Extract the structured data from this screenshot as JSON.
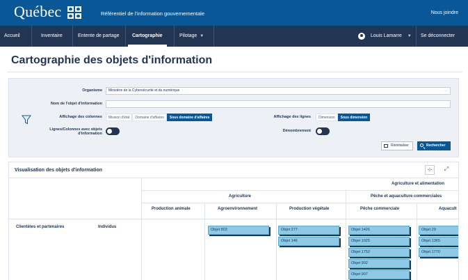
{
  "header": {
    "logo_text": "Québec",
    "site_title": "Référentiel de l'information gouvernementale",
    "contact_link": "Nous joindre",
    "brand_color": "#095797"
  },
  "nav": {
    "items": [
      {
        "label": "Accueil"
      },
      {
        "label": "Inventaire"
      },
      {
        "label": "Entente de partage"
      },
      {
        "label": "Cartographie",
        "active": true
      },
      {
        "label": "Pilotage"
      }
    ],
    "user_name": "Louis Lamarre",
    "logout": "Se déconnecter",
    "nav_color": "#223654"
  },
  "page": {
    "title": "Cartographie des objets d'information"
  },
  "filters": {
    "organisme_label": "Organisme",
    "organisme_value": "Ministère de la Cybersécurité et du numérique",
    "nom_label": "Nom de l'objet d'information",
    "nom_value": "",
    "colonnes_label": "Affichage des colonnes",
    "colonnes_options": [
      "Mission d'état",
      "Domaine d'affaires",
      "Sous domaine d'affaires"
    ],
    "colonnes_selected": "Sous domaine d'affaires",
    "lignes_label": "Affichage des lignes",
    "lignes_options": [
      "Dimension",
      "Sous dimension"
    ],
    "lignes_selected": "Sous dimension",
    "lignes_colonnes_label_1": "Lignes/Colonnes avec objets",
    "lignes_colonnes_label_2": "d'information",
    "denombrement_label": "Dénombrement",
    "reset_label": "Réinitialiser",
    "search_label": "Rechercher"
  },
  "viz": {
    "title": "Visualisation des objets d'information",
    "mission": "Agriculture et alimentation",
    "domains": [
      "Agriculture",
      "Pêche et aquaculture commerciales"
    ],
    "subdomains": [
      "Production animale",
      "Agroenvironnement",
      "Production végétale",
      "Pêche commerciale",
      "Aquacult"
    ],
    "row_dimension": "Clientèles et partenaires",
    "row_subdimension": "Individus",
    "cells": [
      {
        "column": "Agroenvironnement",
        "objects": [
          "Objet 803"
        ]
      },
      {
        "column": "Production végétale",
        "objects": [
          "Objet 277",
          "Objet 146"
        ]
      },
      {
        "column": "Pêche commerciale",
        "objects": [
          "Objet 1426",
          "Objet 1025",
          "Objet 1752",
          "Objet 902",
          "Objet 907"
        ]
      },
      {
        "column": "Aquacult",
        "objects": [
          "Objet 29",
          "Objet 1365",
          "Objet 1770"
        ]
      }
    ]
  }
}
